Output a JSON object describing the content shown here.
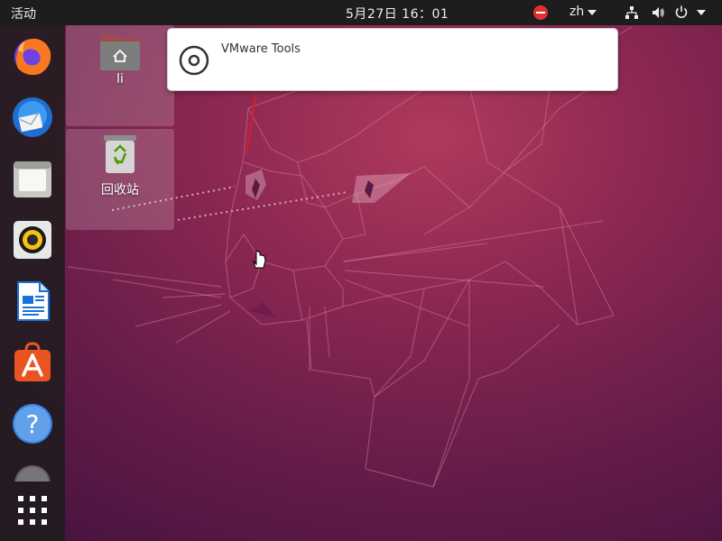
{
  "topbar": {
    "activities": "活动",
    "clock": "5月27日  16：01",
    "language": "zh",
    "icons": [
      "do-not-disturb-icon",
      "network-icon",
      "volume-icon",
      "power-icon"
    ]
  },
  "dock": {
    "apps": [
      {
        "name": "Firefox",
        "icon": "firefox-icon"
      },
      {
        "name": "Thunderbird",
        "icon": "thunderbird-icon"
      },
      {
        "name": "Files",
        "icon": "files-icon"
      },
      {
        "name": "Rhythmbox",
        "icon": "rhythmbox-icon"
      },
      {
        "name": "LibreOffice Writer",
        "icon": "writer-icon"
      },
      {
        "name": "Ubuntu Software",
        "icon": "software-icon"
      },
      {
        "name": "Help",
        "icon": "help-icon"
      },
      {
        "name": "Disc",
        "icon": "disc-icon"
      }
    ],
    "show_apps_icon": "app-grid-icon"
  },
  "desktop": {
    "home_label": "li",
    "trash_label": "回收站"
  },
  "notification": {
    "title": "VMware Tools",
    "icon": "disc-icon"
  },
  "colors": {
    "topbar": "#1d1d1d",
    "dock": "#1c1c1c",
    "wallpaper": "#7a2350",
    "trash_green": "#4e9a06",
    "software_orange": "#e95420",
    "help_blue": "#3584e4",
    "annotation_red": "#e01b24"
  }
}
